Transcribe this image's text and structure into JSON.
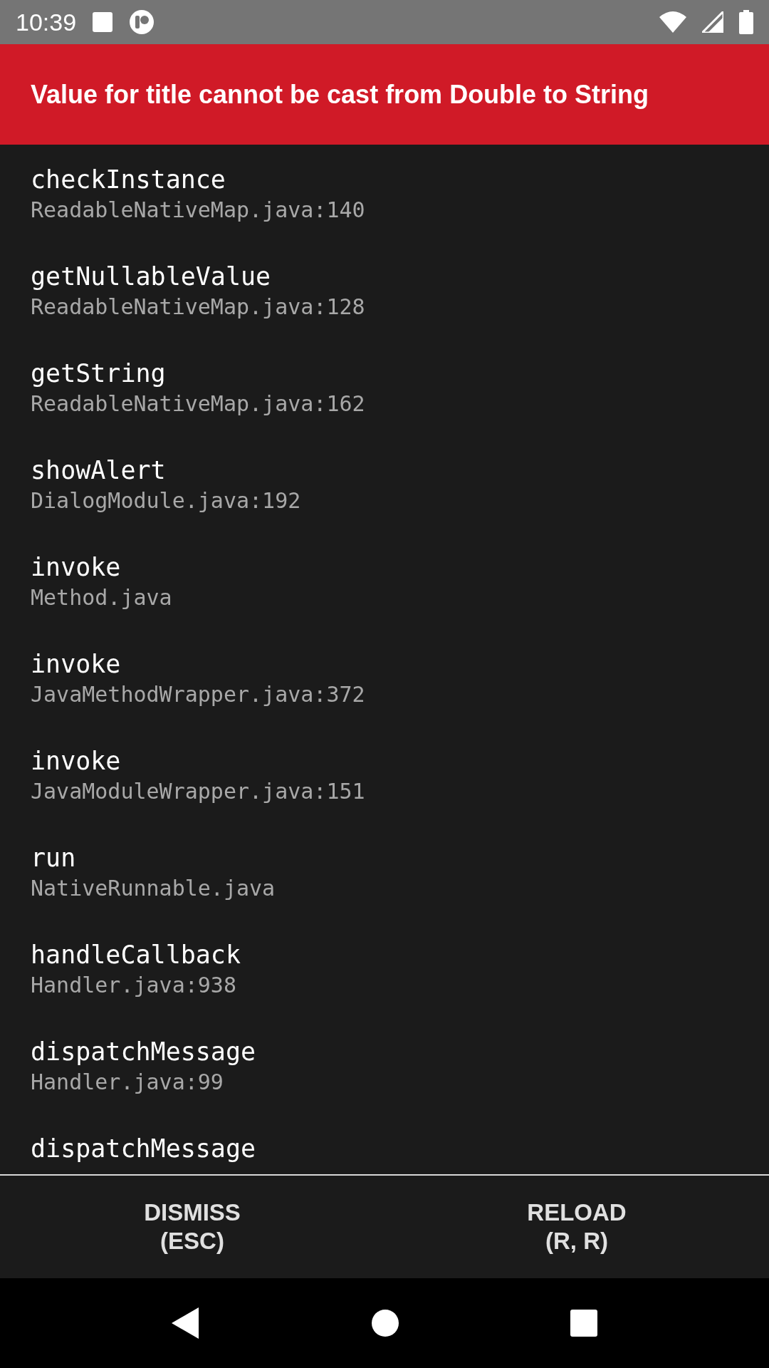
{
  "status_bar": {
    "time": "10:39"
  },
  "error": {
    "title": "Value for title cannot be cast from Double to String"
  },
  "frames": [
    {
      "method": "checkInstance",
      "file": "ReadableNativeMap.java:140"
    },
    {
      "method": "getNullableValue",
      "file": "ReadableNativeMap.java:128"
    },
    {
      "method": "getString",
      "file": "ReadableNativeMap.java:162"
    },
    {
      "method": "showAlert",
      "file": "DialogModule.java:192"
    },
    {
      "method": "invoke",
      "file": "Method.java"
    },
    {
      "method": "invoke",
      "file": "JavaMethodWrapper.java:372"
    },
    {
      "method": "invoke",
      "file": "JavaModuleWrapper.java:151"
    },
    {
      "method": "run",
      "file": "NativeRunnable.java"
    },
    {
      "method": "handleCallback",
      "file": "Handler.java:938"
    },
    {
      "method": "dispatchMessage",
      "file": "Handler.java:99"
    },
    {
      "method": "dispatchMessage"
    }
  ],
  "buttons": [
    {
      "label": "DISMISS\n(ESC)"
    },
    {
      "label": "RELOAD\n(R, R)"
    }
  ]
}
